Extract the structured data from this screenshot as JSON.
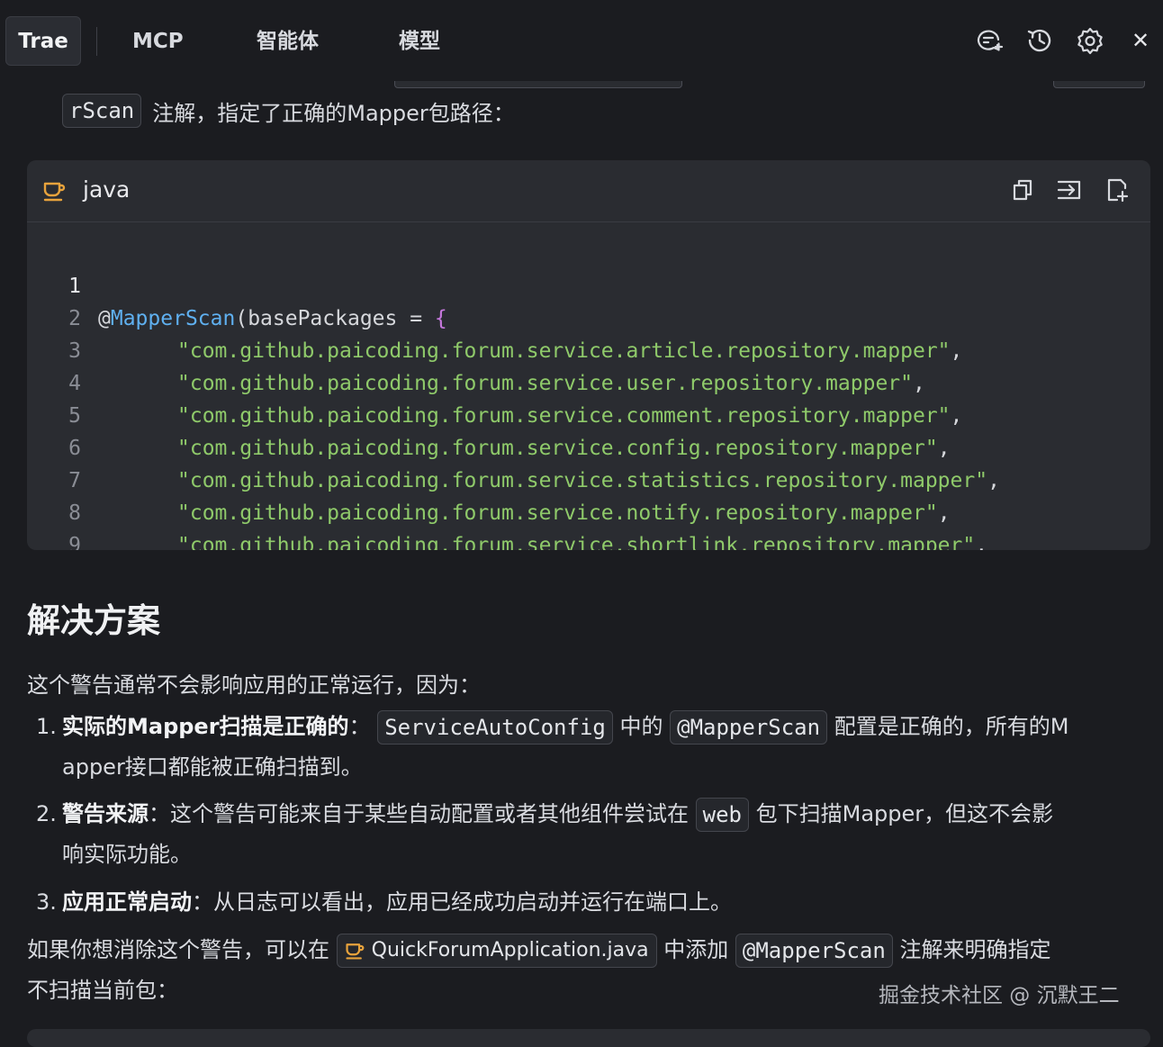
{
  "topbar": {
    "tabs": [
      "Trae",
      "MCP",
      "智能体",
      "模型"
    ],
    "icons": [
      "new-chat-icon",
      "history-icon",
      "gear-icon",
      "close-icon"
    ],
    "close_glyph": "✕"
  },
  "intro": {
    "code": "rScan",
    "text": "注解，指定了正确的Mapper包路径："
  },
  "codeblock": {
    "language": "java",
    "icons": [
      "java-icon",
      "copy-icon",
      "insert-icon",
      "apply-icon"
    ],
    "lines": [
      {
        "num": "1",
        "at": "@",
        "ann": "MapperScan",
        "rest": "(basePackages = ",
        "brace": "{"
      },
      {
        "num": "2",
        "str": "\"com.github.paicoding.forum.service.article.repository.mapper\"",
        "tail": ","
      },
      {
        "num": "3",
        "str": "\"com.github.paicoding.forum.service.user.repository.mapper\"",
        "tail": ","
      },
      {
        "num": "4",
        "str": "\"com.github.paicoding.forum.service.comment.repository.mapper\"",
        "tail": ","
      },
      {
        "num": "5",
        "str": "\"com.github.paicoding.forum.service.config.repository.mapper\"",
        "tail": ","
      },
      {
        "num": "6",
        "str": "\"com.github.paicoding.forum.service.statistics.repository.mapper\"",
        "tail": ","
      },
      {
        "num": "7",
        "str": "\"com.github.paicoding.forum.service.notify.repository.mapper\"",
        "tail": ","
      },
      {
        "num": "8",
        "str": "\"com.github.paicoding.forum.service.shortlink.repository.mapper\"",
        "tail": ","
      },
      {
        "num": "9",
        "brace": "})"
      }
    ]
  },
  "content": {
    "heading": "解决方案",
    "lead": "这个警告通常不会影响应用的正常运行，因为：",
    "items": [
      {
        "num": "1.",
        "bold": "实际的Mapper扫描是正确的",
        "colon": "：",
        "code1": "ServiceAutoConfig",
        "mid": "中的",
        "code2": "@MapperScan",
        "after": "配置是正确的，所有的M",
        "line2": "apper接口都能被正确扫描到。"
      },
      {
        "num": "2.",
        "bold": "警告来源",
        "colon": "：",
        "text": "这个警告可能来自于某些自动配置或者其他组件尝试在",
        "code1": "web",
        "after": "包下扫描Mapper，但这不会影",
        "line2": "响实际功能。"
      },
      {
        "num": "3.",
        "bold": "应用正常启动",
        "colon": "：",
        "text": "从日志可以看出，应用已经成功启动并运行在端口上。"
      }
    ],
    "suggestion": {
      "pre": "如果你想消除这个警告，可以在",
      "file": "QuickForumApplication.java",
      "mid": "中添加",
      "code": "@MapperScan",
      "post": "注解来明确指定",
      "line2": "不扫描当前包："
    },
    "watermark": "掘金技术社区 @ 沉默王二"
  },
  "colors": {
    "background": "#1b1c20",
    "code_bg": "#2a2c31",
    "string": "#8fca6a",
    "annotation": "#5fb0f0",
    "brace": "#c678dd",
    "icon_accent": "#e8a33c"
  }
}
